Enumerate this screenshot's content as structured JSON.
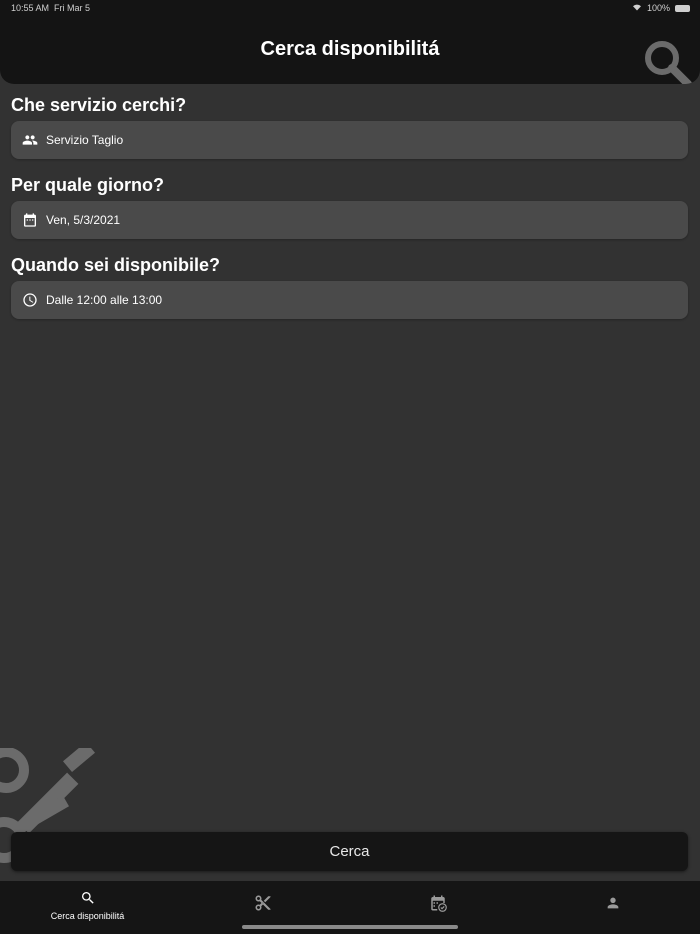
{
  "status_bar": {
    "time": "10:55 AM",
    "date": "Fri Mar 5",
    "battery": "100%"
  },
  "header": {
    "title": "Cerca disponibilitá",
    "search_icon": "search-icon"
  },
  "form": {
    "service": {
      "question": "Che servizio cerchi?",
      "value": "Servizio Taglio",
      "icon": "people-icon"
    },
    "day": {
      "question": "Per quale giorno?",
      "value": "Ven, 5/3/2021",
      "icon": "calendar-icon"
    },
    "time": {
      "question": "Quando sei disponibile?",
      "value": "Dalle 12:00 alle 13:00",
      "icon": "clock-icon"
    }
  },
  "cerca_button": {
    "label": "Cerca"
  },
  "tabbar": {
    "tabs": [
      {
        "label": "Cerca disponibilitá",
        "icon": "search-icon",
        "active": true
      },
      {
        "label": "",
        "icon": "scissors-icon",
        "active": false
      },
      {
        "label": "",
        "icon": "calendar-check-icon",
        "active": false
      },
      {
        "label": "",
        "icon": "person-icon",
        "active": false
      }
    ]
  },
  "colors": {
    "background": "#323232",
    "header": "#141414",
    "field": "#4a4a4a",
    "button": "#151515",
    "text": "#ffffff"
  }
}
